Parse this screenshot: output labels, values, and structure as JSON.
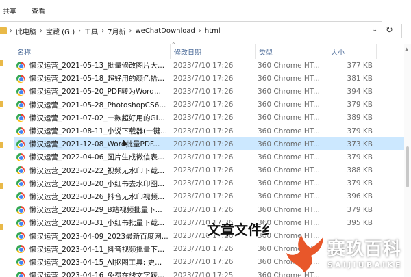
{
  "ribbon": {
    "tabs": [
      "共享",
      "查看"
    ]
  },
  "address_bar": {
    "segments": [
      "此电脑",
      "宝藏 (G:)",
      "工具",
      "7月新",
      "weChatDownload",
      "html"
    ]
  },
  "columns": {
    "name": "名称",
    "date": "修改日期",
    "type": "类型",
    "size": "大小"
  },
  "files": [
    {
      "name": "懒汉运营_2021-05-13_批量修改图片大...",
      "date": "2023/7/10 17:26",
      "type": "360 Chrome HT...",
      "size": "377 KB"
    },
    {
      "name": "懒汉运营_2021-05-18_超好用的颜色拾...",
      "date": "2023/7/10 17:26",
      "type": "360 Chrome HT...",
      "size": "381 KB"
    },
    {
      "name": "懒汉运营_2021-05-20_PDF转为Word...",
      "date": "2023/7/10 17:26",
      "type": "360 Chrome HT...",
      "size": "394 KB"
    },
    {
      "name": "懒汉运营_2021-05-28_PhotoshopCS6...",
      "date": "2023/7/10 17:26",
      "type": "360 Chrome HT...",
      "size": "379 KB"
    },
    {
      "name": "懒汉运营_2021-07-02_一款超好用的GI...",
      "date": "2023/7/10 17:26",
      "type": "360 Chrome HT...",
      "size": "389 KB"
    },
    {
      "name": "懒汉运营_2021-08-11_小说下载器(一键...",
      "date": "2023/7/10 17:26",
      "type": "360 Chrome HT...",
      "size": "379 KB"
    },
    {
      "name": "懒汉运营_2021-12-08_Word批量PDF...",
      "date": "2023/7/10 17:26",
      "type": "360 Chrome HT...",
      "size": "373 KB",
      "selected": true
    },
    {
      "name": "懒汉运营_2022-04-06_图片生成微信表...",
      "date": "2023/7/10 17:26",
      "type": "360 Chrome HT...",
      "size": "379 KB"
    },
    {
      "name": "懒汉运营_2023-02-22_视频无水印下载...",
      "date": "2023/7/10 17:26",
      "type": "360 Chrome HT...",
      "size": "388 KB"
    },
    {
      "name": "懒汉运营_2023-03-20_小红书去水印图...",
      "date": "2023/7/10 17:26",
      "type": "360 Chrome HT...",
      "size": "379 KB"
    },
    {
      "name": "懒汉运营_2023-03-26_抖音无水印视频...",
      "date": "2023/7/10 17:26",
      "type": "360 Chrome HT...",
      "size": "396 KB"
    },
    {
      "name": "懒汉运营_2023-03-29_B站视频批量下...",
      "date": "2023/7/10 17:26",
      "type": "360 Chrome HT...",
      "size": "379 KB"
    },
    {
      "name": "懒汉运营_2023-03-31_小红书批量下载...",
      "date": "2023/7/10 17:26",
      "type": "360 Chrome HT...",
      "size": "395 KB"
    },
    {
      "name": "懒汉运营_2023-04-09_2023最新百度网...",
      "date": "2023/7/10 17:26",
      "type": "360 Chrome HT...",
      "size": ""
    },
    {
      "name": "懒汉运营_2023-04-11_抖音视频批量下...",
      "date": "2023/7/10 17:26",
      "type": "360 Chrome HT...",
      "size": ""
    },
    {
      "name": "懒汉运营_2023-04-15_AI抠图工具: 史...",
      "date": "2023/7/10 17:26",
      "type": "360 Chrome HT...",
      "size": ""
    },
    {
      "name": "懒汉运营_2023-04-16_免费在线文字转...",
      "date": "2023/7/10 17:25",
      "type": "360 Chrome HT...",
      "size": ""
    }
  ],
  "overlay": {
    "caption": "文章文件纟"
  },
  "watermark": {
    "brand_cn": "赛玖百科",
    "brand_en": "SAIJIUBAIKE",
    "color": "#e8572a"
  },
  "colors": {
    "selection": "#cce8ff",
    "header_text": "#4d6c99",
    "folder": "#e9b948"
  },
  "icons": {
    "file": "chrome-html-icon",
    "refresh": "refresh-icon",
    "dropdown": "chevron-down-icon"
  }
}
